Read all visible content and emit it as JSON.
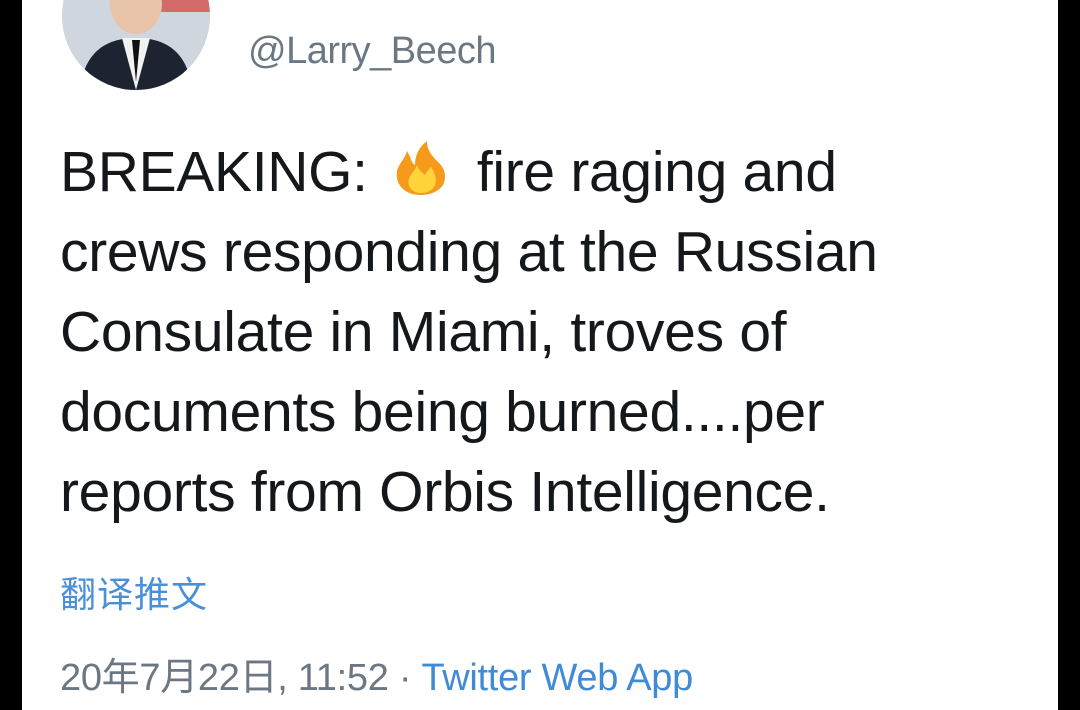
{
  "user": {
    "handle": "@Larry_Beech"
  },
  "tweet": {
    "prefix": "BREAKING:",
    "emoji": "fire-icon",
    "line1_rest": "fire raging and",
    "line2": "crews responding at the Russian",
    "line3": "Consulate in Miami, troves of",
    "line4": "documents being burned....per",
    "line5": "reports from Orbis Intelligence."
  },
  "translate_label": "翻译推文",
  "meta": {
    "timestamp": "20年7月22日, 11:52",
    "separator": "·",
    "source": "Twitter Web App"
  },
  "colors": {
    "link": "#4a90d9",
    "secondary_text": "#6b7782",
    "text": "#15181b",
    "background": "#ffffff",
    "frame": "#000000"
  }
}
